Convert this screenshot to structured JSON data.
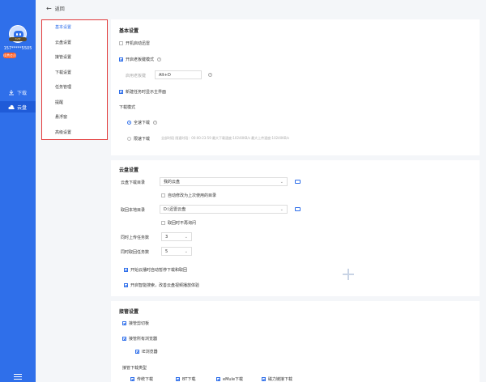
{
  "nav": {
    "back": "返回",
    "username": "157*****5505",
    "renew": "续费会员",
    "items": [
      {
        "label": "下载"
      },
      {
        "label": "云盘"
      }
    ]
  },
  "categories": [
    "基本设置",
    "云盘设置",
    "接管设置",
    "下载设置",
    "任务管理",
    "提醒",
    "悬浮窗",
    "高级设置"
  ],
  "basic": {
    "title": "基本设置",
    "autostart": "开机启动迅雷",
    "boss_key_label": "开启老板键模式",
    "boss_key_hint": "启用老板键",
    "boss_key_value": "Alt+D",
    "new_task_show": "新建任务时显示主界面",
    "download_mode": "下载模式",
    "full_speed": "全速下载",
    "limit_speed": "限速下载",
    "limit_desc": "全部时段   限速时段：00:00-23:59   最大下载速度:10240KB/s   最大上传速度:10240KB/s"
  },
  "cloud": {
    "title": "云盘设置",
    "dir_label": "云盘下载目录",
    "dir_value": "我的云盘",
    "auto_last": "自动修改为上次使用的目录",
    "local_label": "取回本地目录",
    "local_value": "D:\\迅雷云盘",
    "no_ask": "取回时不再询问",
    "upload_label": "同时上传任务数",
    "upload_value": "3",
    "fetch_label": "同时取回任务数",
    "fetch_value": "5",
    "pause_when_play": "开始云播时自动暂停下载和取回",
    "smart_search": "开启智能搜索，改善云盘视频播放体验"
  },
  "takeover": {
    "title": "接管设置",
    "clipboard": "接管剪切板",
    "browsers": "接管所有浏览器",
    "ie": "IE浏览器",
    "types_label": "接管下载类型",
    "types": [
      "传统下载",
      "BT下载",
      "eMule下载",
      "磁力链接下载"
    ]
  }
}
